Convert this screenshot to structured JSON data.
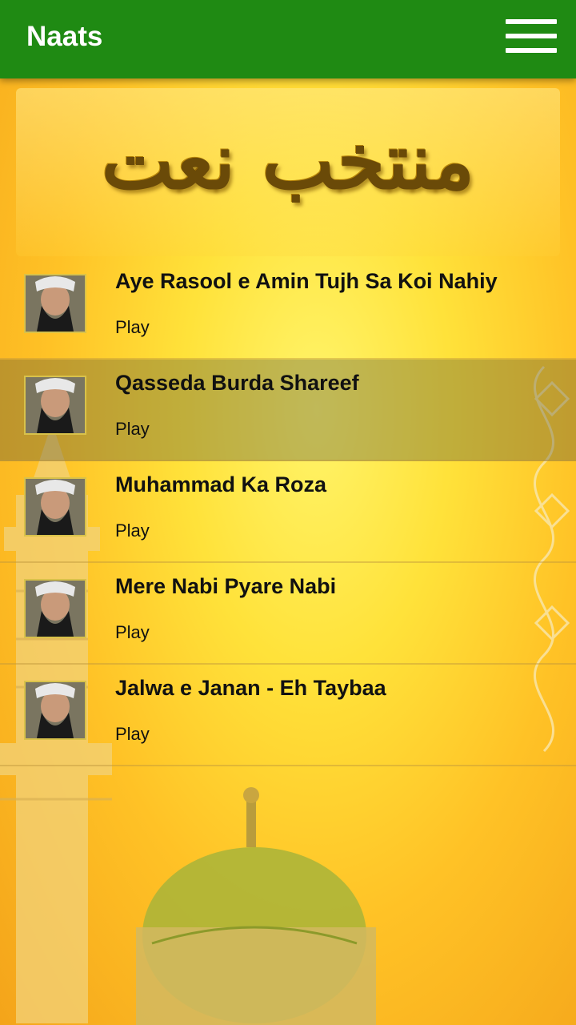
{
  "appbar": {
    "title": "Naats",
    "menu_icon": "hamburger-menu-icon",
    "color": "#1f8a13"
  },
  "banner": {
    "text": "منتخب نعت"
  },
  "items": [
    {
      "title": "Aye Rasool e Amin Tujh Sa Koi Nahiy",
      "subtitle": "Play",
      "selected": false
    },
    {
      "title": "Qasseda Burda Shareef",
      "subtitle": "Play",
      "selected": true
    },
    {
      "title": "Muhammad Ka Roza",
      "subtitle": "Play",
      "selected": false
    },
    {
      "title": "Mere Nabi Pyare Nabi",
      "subtitle": "Play",
      "selected": false
    },
    {
      "title": "Jalwa e Janan - Eh Taybaa",
      "subtitle": "Play",
      "selected": false
    }
  ]
}
